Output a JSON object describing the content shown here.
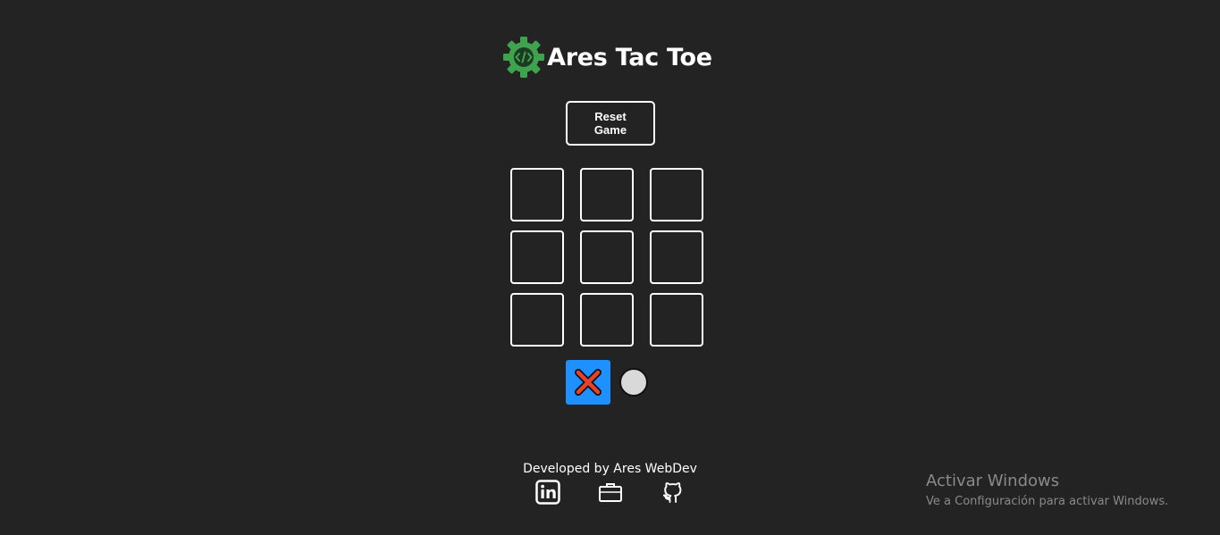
{
  "header": {
    "title": "Ares Tac Toe",
    "logo_icon": "gear-code-icon",
    "logo_color": "#3fa34d"
  },
  "controls": {
    "reset_label": "Reset Game"
  },
  "board": {
    "cells": [
      "",
      "",
      "",
      "",
      "",
      "",
      "",
      "",
      ""
    ]
  },
  "players": {
    "active": "x",
    "x_icon": "x-mark-icon",
    "x_bg_color": "#1e90ff",
    "x_mark_color": "#e8402a",
    "o_icon": "circle-icon",
    "o_color": "#d9d9d9"
  },
  "footer": {
    "credit": "Developed by Ares WebDev",
    "links": [
      {
        "icon": "linkedin-icon"
      },
      {
        "icon": "briefcase-icon"
      },
      {
        "icon": "github-icon"
      }
    ]
  },
  "watermark": {
    "title": "Activar Windows",
    "subtitle": "Ve a Configuración para activar Windows."
  },
  "colors": {
    "background": "#232323",
    "foreground": "#ffffff"
  }
}
